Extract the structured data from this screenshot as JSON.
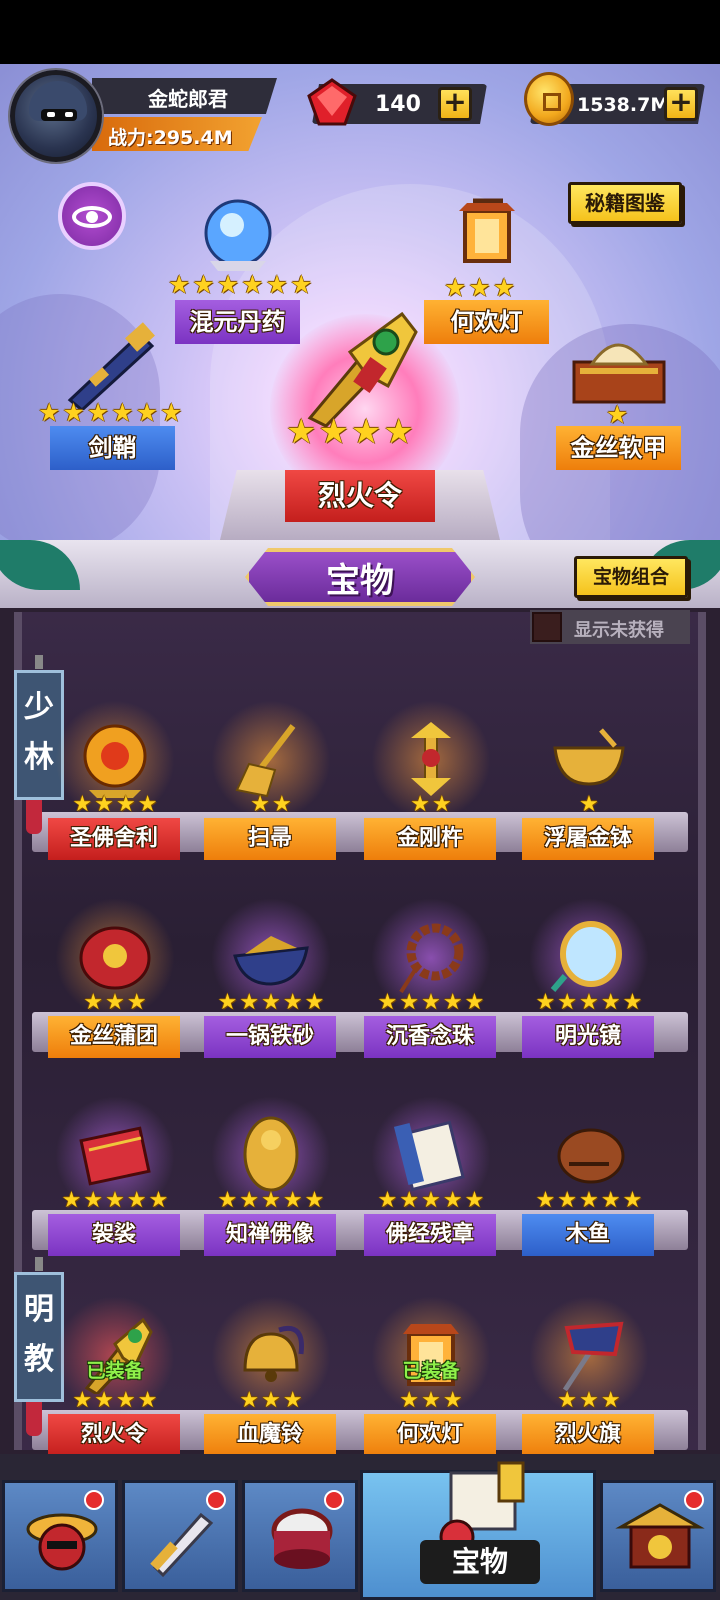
{
  "player": {
    "name": "金蛇郎君",
    "power": "战力:295.4M"
  },
  "currency": {
    "gems": "140",
    "gold": "1538.7M"
  },
  "buttons": {
    "secret_book": "秘籍图鉴",
    "treasure_combo": "宝物组合",
    "show_unobtained": "显示未获得"
  },
  "title": "宝物",
  "equipped_slots": [
    {
      "name": "混元丹药",
      "stars": 6,
      "banner": "purple",
      "icon": "crystal-orb-icon"
    },
    {
      "name": "何欢灯",
      "stars": 3,
      "banner": "orange",
      "icon": "lantern-icon"
    },
    {
      "name": "剑鞘",
      "stars": 6,
      "banner": "blue",
      "icon": "scabbard-icon"
    },
    {
      "name": "烈火令",
      "stars": 4,
      "banner": "red",
      "icon": "fire-token-icon"
    },
    {
      "name": "金丝软甲",
      "stars": 1,
      "banner": "orange",
      "icon": "armor-icon"
    }
  ],
  "sections": [
    {
      "label_chars": [
        "少",
        "林"
      ]
    },
    {
      "label_chars": [
        "明",
        "教"
      ]
    }
  ],
  "equipped_label": "已装备",
  "shelves": [
    {
      "items": [
        {
          "name": "圣佛舍利",
          "stars": 4,
          "banner": "red",
          "halo": "orange",
          "icon": "relic-orb-icon"
        },
        {
          "name": "扫帚",
          "stars": 2,
          "banner": "orange",
          "halo": "orange",
          "icon": "broom-icon"
        },
        {
          "name": "金刚杵",
          "stars": 2,
          "banner": "orange",
          "halo": "orange",
          "icon": "vajra-icon"
        },
        {
          "name": "浮屠金钵",
          "stars": 1,
          "banner": "orange",
          "halo": "none",
          "icon": "golden-bowl-icon"
        }
      ]
    },
    {
      "items": [
        {
          "name": "金丝蒲团",
          "stars": 3,
          "banner": "orange",
          "halo": "orange",
          "icon": "cushion-icon"
        },
        {
          "name": "一锅铁砂",
          "stars": 5,
          "banner": "purple",
          "halo": "purple",
          "icon": "iron-sand-pot-icon"
        },
        {
          "name": "沉香念珠",
          "stars": 5,
          "banner": "purple",
          "halo": "purple",
          "icon": "prayer-beads-icon"
        },
        {
          "name": "明光镜",
          "stars": 5,
          "banner": "purple",
          "halo": "purple",
          "icon": "mirror-icon"
        }
      ]
    },
    {
      "items": [
        {
          "name": "袈裟",
          "stars": 5,
          "banner": "purple",
          "halo": "purple",
          "icon": "kasaya-icon"
        },
        {
          "name": "知禅佛像",
          "stars": 5,
          "banner": "purple",
          "halo": "purple",
          "icon": "buddha-statue-icon"
        },
        {
          "name": "佛经残章",
          "stars": 5,
          "banner": "purple",
          "halo": "purple",
          "icon": "sutra-scroll-icon"
        },
        {
          "name": "木鱼",
          "stars": 5,
          "banner": "blue",
          "halo": "none",
          "icon": "wooden-fish-icon"
        }
      ]
    },
    {
      "items": [
        {
          "name": "烈火令",
          "stars": 4,
          "banner": "red",
          "halo": "red",
          "icon": "fire-token-icon",
          "equipped": true
        },
        {
          "name": "血魔铃",
          "stars": 3,
          "banner": "orange",
          "halo": "orange",
          "icon": "demon-bell-icon"
        },
        {
          "name": "何欢灯",
          "stars": 3,
          "banner": "orange",
          "halo": "orange",
          "icon": "lantern-icon",
          "equipped": true
        },
        {
          "name": "烈火旗",
          "stars": 3,
          "banner": "orange",
          "halo": "orange",
          "icon": "fire-flag-icon"
        }
      ]
    }
  ],
  "nav": {
    "active_label": "宝物",
    "tabs": [
      "hero",
      "weapon",
      "drum",
      "treasure",
      "shop"
    ]
  },
  "colors": {
    "banner_red": "#c41f1d",
    "banner_orange": "#ee7e0b",
    "banner_purple": "#7b33c2",
    "banner_blue": "#2d5fc9",
    "star": "#ffd21f",
    "equipped_text": "#8ff04a"
  }
}
